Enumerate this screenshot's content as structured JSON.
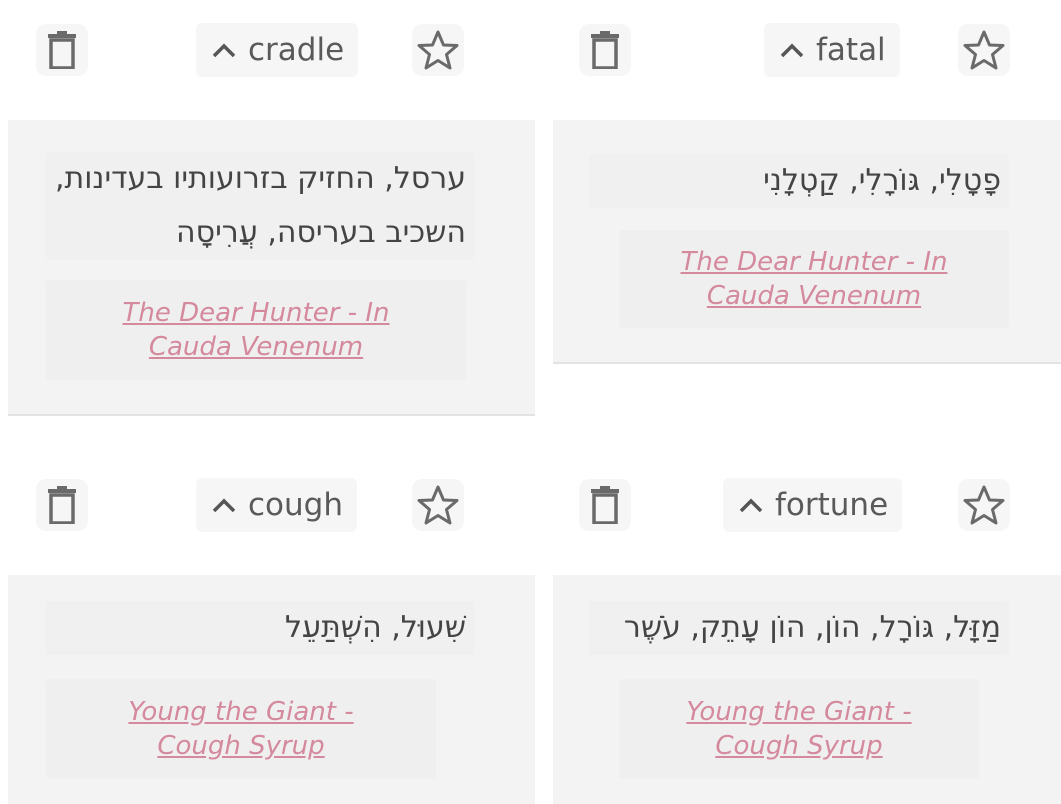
{
  "cards": [
    {
      "word": "cradle",
      "translation": "ערסל, החזיק בזרועותיו בעדינות, השכיב בעריסה, עֲרִיסָה",
      "source": "The Dear Hunter - In Cauda Venenum"
    },
    {
      "word": "fatal",
      "translation": "פָטָלִי, גּוֹרָלִי, קַטְלָנִי",
      "source": "The Dear Hunter - In Cauda Venenum"
    },
    {
      "word": "cough",
      "translation": "שִׁעוּל, הִשְׁתַּעֵל",
      "source": "Young the Giant - Cough Syrup"
    },
    {
      "word": "fortune",
      "translation": "מַזָּל, גּוֹרָל, הוֹן, הוֹן עָתֵק, עֹשֶׁר",
      "source": "Young the Giant - Cough Syrup"
    }
  ],
  "icons": {
    "delete": "trash-icon",
    "expand": "chevron-up-icon",
    "favorite": "star-outline-icon"
  },
  "colors": {
    "icon": "#6a6a6a",
    "source_link": "#d4899d",
    "card_body": "#f3f3f3"
  }
}
